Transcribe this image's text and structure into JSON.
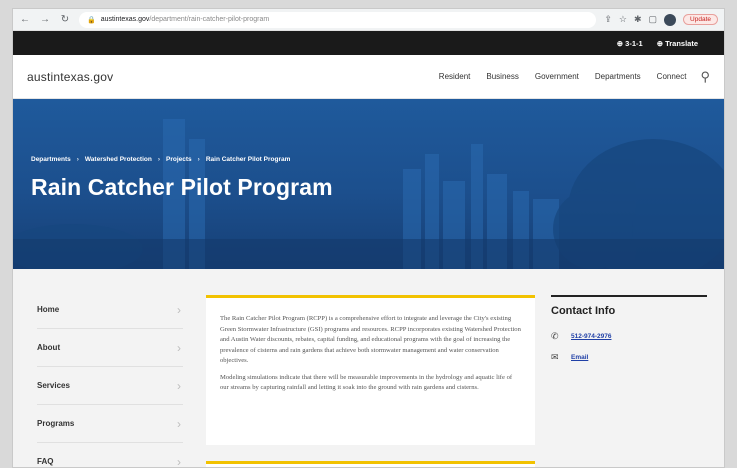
{
  "browser": {
    "url_host": "austintexas.gov",
    "url_path": "/department/rain-catcher-pilot-program",
    "update_label": "Update"
  },
  "utility": {
    "phone": "3-1-1",
    "translate": "Translate"
  },
  "header": {
    "logo": "austintexas.gov",
    "nav": [
      "Resident",
      "Business",
      "Government",
      "Departments",
      "Connect"
    ]
  },
  "hero": {
    "breadcrumbs": [
      "Departments",
      "Watershed Protection",
      "Projects",
      "Rain Catcher Pilot Program"
    ],
    "title": "Rain Catcher Pilot Program"
  },
  "sidenav": {
    "items": [
      "Home",
      "About",
      "Services",
      "Programs",
      "FAQ"
    ]
  },
  "article": {
    "p1": "The Rain Catcher Pilot Program (RCPP) is a comprehensive effort to integrate and leverage the City's existing Green Stormwater Infrastructure (GSI) programs and resources. RCPP incorporates existing Watershed Protection and Austin Water discounts, rebates, capital funding, and educational programs with the goal of increasing the prevalence of cisterns and rain gardens that achieve both stormwater management and water conservation objectives.",
    "p2": "Modeling simulations indicate that there will be measurable improvements in the hydrology and aquatic life of our streams by capturing rainfall and letting it soak into the ground with rain gardens and cisterns."
  },
  "contact": {
    "title": "Contact Info",
    "phone": "512-974-2976",
    "email": "Email"
  }
}
